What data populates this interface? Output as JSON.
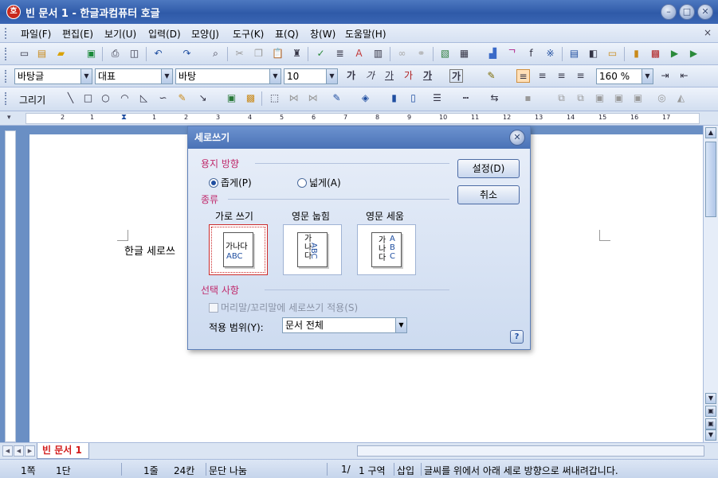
{
  "window": {
    "title": "빈 문서 1 - 한글과컴퓨터 호글",
    "app_icon": "호",
    "minimize": "–",
    "maximize": "□",
    "close": "✕"
  },
  "menu": [
    "파일(F)",
    "편집(E)",
    "보기(U)",
    "입력(D)",
    "모양(J)",
    "도구(K)",
    "표(Q)",
    "창(W)",
    "도움말(H)"
  ],
  "menu_close": "×",
  "format_bar": {
    "style": "바탕글",
    "lang": "대표",
    "font": "바탕",
    "size": "10",
    "zoom": "160 %",
    "bold": "가",
    "italic": "가",
    "underline": "가",
    "strike": "가",
    "char_color": "가",
    "char_shape": "가"
  },
  "drawing_bar": {
    "label": "그리기"
  },
  "ruler_numbers": [
    "2",
    "1",
    "1",
    "2",
    "3",
    "4",
    "5",
    "6",
    "7",
    "8",
    "9",
    "10",
    "11",
    "12",
    "13",
    "14",
    "15",
    "16",
    "17"
  ],
  "document": {
    "text": "한글 세로쓰"
  },
  "tab": {
    "label": "빈 문서 1"
  },
  "status": {
    "page": "1쪽",
    "column": "1단",
    "line": "1줄",
    "col_pos": "24칸",
    "layout": "문단 나눔",
    "page_count": "1/",
    "section": "1 구역",
    "mode": "삽입",
    "message": "글씨를 위에서 아래 세로 방향으로 써내려갑니다."
  },
  "dialog": {
    "title": "세로쓰기",
    "paper_orientation": {
      "label": "용지 방향",
      "portrait": "좁게(P)",
      "landscape": "넓게(A)",
      "selected": "portrait"
    },
    "type": {
      "label": "종류",
      "options": [
        {
          "label": "가로 쓰기",
          "preview": [
            "가나다",
            "ABC"
          ]
        },
        {
          "label": "영문 눕힘",
          "preview": [
            "가나다",
            "ABC"
          ]
        },
        {
          "label": "영문 세움",
          "preview": [
            "가나다",
            "ABC"
          ]
        }
      ],
      "selected": 0
    },
    "options": {
      "label": "선택 사항",
      "header_footer_checkbox": "머리말/꼬리말에 세로쓰기 적용(S)",
      "scope_label": "적용 범위(Y):",
      "scope_value": "문서 전체"
    },
    "ok_button": "설정(D)",
    "cancel_button": "취소"
  }
}
